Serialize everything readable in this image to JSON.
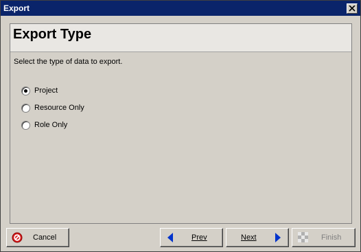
{
  "window": {
    "title": "Export"
  },
  "panel": {
    "title": "Export Type",
    "instruction": "Select the type of data to export."
  },
  "options": [
    {
      "label": "Project",
      "selected": true
    },
    {
      "label": "Resource Only",
      "selected": false
    },
    {
      "label": "Role Only",
      "selected": false
    }
  ],
  "buttons": {
    "cancel": "Cancel",
    "prev": "Prev",
    "next": "Next",
    "finish": "Finish"
  },
  "colors": {
    "titlebar": "#0a246a",
    "dialog_bg": "#d4d0c8",
    "cancel_icon": "#d71f1f",
    "arrow": "#0033cc",
    "disabled_text": "#808080"
  }
}
